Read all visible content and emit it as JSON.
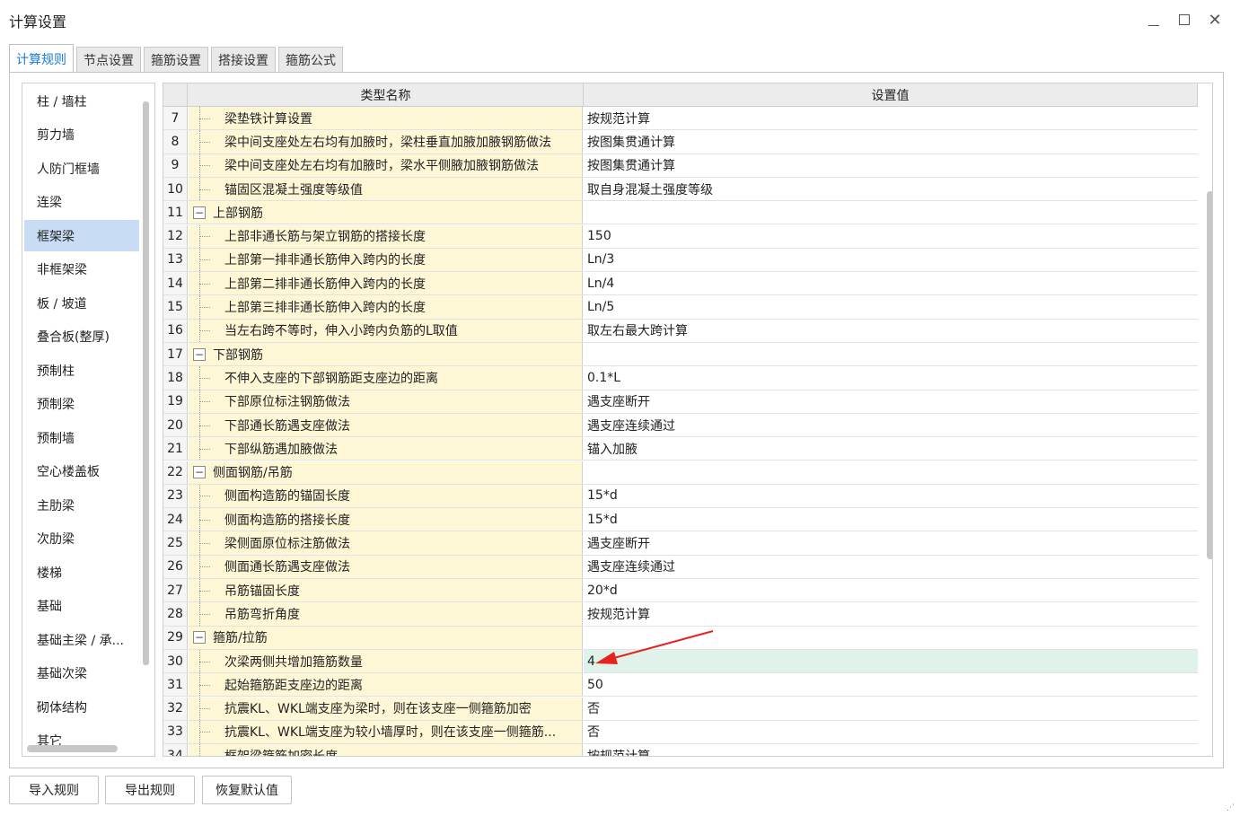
{
  "window": {
    "title": "计算设置"
  },
  "tabs": [
    {
      "label": "计算规则",
      "active": true
    },
    {
      "label": "节点设置",
      "active": false
    },
    {
      "label": "箍筋设置",
      "active": false
    },
    {
      "label": "搭接设置",
      "active": false
    },
    {
      "label": "箍筋公式",
      "active": false
    }
  ],
  "sidebar": {
    "selected": "框架梁",
    "items": [
      "柱 / 墙柱",
      "剪力墙",
      "人防门框墙",
      "连梁",
      "框架梁",
      "非框架梁",
      "板 / 坡道",
      "叠合板(整厚)",
      "预制柱",
      "预制梁",
      "预制墙",
      "空心楼盖板",
      "主肋梁",
      "次肋梁",
      "楼梯",
      "基础",
      "基础主梁 / 承...",
      "基础次梁",
      "砌体结构",
      "其它"
    ]
  },
  "grid": {
    "columns": [
      "类型名称",
      "设置值"
    ],
    "rows": [
      {
        "num": "7",
        "name": "梁垫铁计算设置",
        "value": "按规范计算",
        "group": false
      },
      {
        "num": "8",
        "name": "梁中间支座处左右均有加腋时，梁柱垂直加腋加腋钢筋做法",
        "value": "按图集贯通计算",
        "group": false
      },
      {
        "num": "9",
        "name": "梁中间支座处左右均有加腋时，梁水平侧腋加腋钢筋做法",
        "value": "按图集贯通计算",
        "group": false
      },
      {
        "num": "10",
        "name": "锚固区混凝土强度等级值",
        "value": "取自身混凝土强度等级",
        "group": false
      },
      {
        "num": "11",
        "name": "上部钢筋",
        "value": "",
        "group": true
      },
      {
        "num": "12",
        "name": "上部非通长筋与架立钢筋的搭接长度",
        "value": "150",
        "group": false
      },
      {
        "num": "13",
        "name": "上部第一排非通长筋伸入跨内的长度",
        "value": "Ln/3",
        "group": false
      },
      {
        "num": "14",
        "name": "上部第二排非通长筋伸入跨内的长度",
        "value": "Ln/4",
        "group": false
      },
      {
        "num": "15",
        "name": "上部第三排非通长筋伸入跨内的长度",
        "value": "Ln/5",
        "group": false
      },
      {
        "num": "16",
        "name": "当左右跨不等时，伸入小跨内负筋的L取值",
        "value": "取左右最大跨计算",
        "group": false
      },
      {
        "num": "17",
        "name": "下部钢筋",
        "value": "",
        "group": true
      },
      {
        "num": "18",
        "name": "不伸入支座的下部钢筋距支座边的距离",
        "value": "0.1*L",
        "group": false
      },
      {
        "num": "19",
        "name": "下部原位标注钢筋做法",
        "value": "遇支座断开",
        "group": false
      },
      {
        "num": "20",
        "name": "下部通长筋遇支座做法",
        "value": "遇支座连续通过",
        "group": false
      },
      {
        "num": "21",
        "name": "下部纵筋遇加腋做法",
        "value": "锚入加腋",
        "group": false
      },
      {
        "num": "22",
        "name": "侧面钢筋/吊筋",
        "value": "",
        "group": true
      },
      {
        "num": "23",
        "name": "侧面构造筋的锚固长度",
        "value": "15*d",
        "group": false
      },
      {
        "num": "24",
        "name": "侧面构造筋的搭接长度",
        "value": "15*d",
        "group": false
      },
      {
        "num": "25",
        "name": "梁侧面原位标注筋做法",
        "value": "遇支座断开",
        "group": false
      },
      {
        "num": "26",
        "name": "侧面通长筋遇支座做法",
        "value": "遇支座连续通过",
        "group": false
      },
      {
        "num": "27",
        "name": "吊筋锚固长度",
        "value": "20*d",
        "group": false
      },
      {
        "num": "28",
        "name": "吊筋弯折角度",
        "value": "按规范计算",
        "group": false
      },
      {
        "num": "29",
        "name": "箍筋/拉筋",
        "value": "",
        "group": true
      },
      {
        "num": "30",
        "name": "次梁两侧共增加箍筋数量",
        "value": "4",
        "group": false,
        "highlight": true
      },
      {
        "num": "31",
        "name": "起始箍筋距支座边的距离",
        "value": "50",
        "group": false
      },
      {
        "num": "32",
        "name": "抗震KL、WKL端支座为梁时，则在该支座一侧箍筋加密",
        "value": "否",
        "group": false
      },
      {
        "num": "33",
        "name": "抗震KL、WKL端支座为较小墙厚时，则在该支座一侧箍筋...",
        "value": "否",
        "group": false
      },
      {
        "num": "34",
        "name": "框架梁箍筋加密长度",
        "value": "按规范计算",
        "group": false
      }
    ]
  },
  "annotation": {
    "arrow_color": "#e8231f"
  },
  "footer": {
    "import_label": "导入规则",
    "export_label": "导出规则",
    "restore_label": "恢复默认值"
  }
}
